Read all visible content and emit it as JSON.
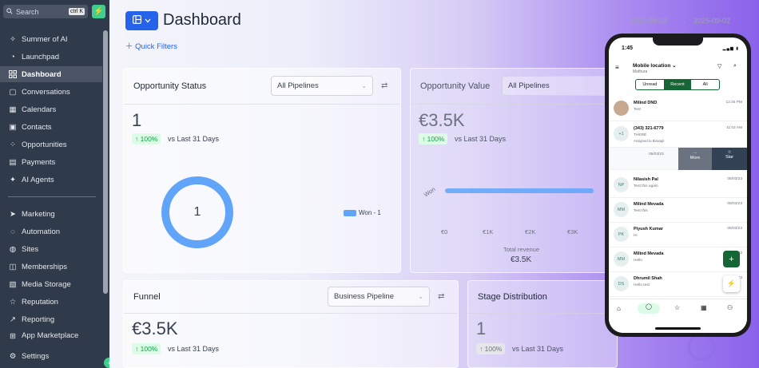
{
  "sidebar": {
    "search_placeholder": "Search",
    "search_shortcut": "ctrl K",
    "items": [
      {
        "label": "Summer of AI",
        "icon": "sparkle-icon"
      },
      {
        "label": "Launchpad",
        "icon": "rocket-icon"
      },
      {
        "label": "Dashboard",
        "icon": "grid-icon"
      },
      {
        "label": "Conversations",
        "icon": "chat-icon"
      },
      {
        "label": "Calendars",
        "icon": "calendar-icon"
      },
      {
        "label": "Contacts",
        "icon": "contacts-icon"
      },
      {
        "label": "Opportunities",
        "icon": "opportunities-icon"
      },
      {
        "label": "Payments",
        "icon": "payments-icon"
      },
      {
        "label": "AI Agents",
        "icon": "ai-agents-icon"
      },
      {
        "label": "Marketing",
        "icon": "marketing-icon"
      },
      {
        "label": "Automation",
        "icon": "automation-icon"
      },
      {
        "label": "Sites",
        "icon": "sites-icon"
      },
      {
        "label": "Memberships",
        "icon": "memberships-icon"
      },
      {
        "label": "Media Storage",
        "icon": "media-icon"
      },
      {
        "label": "Reputation",
        "icon": "star-icon"
      },
      {
        "label": "Reporting",
        "icon": "reporting-icon"
      },
      {
        "label": "App Marketplace",
        "icon": "marketplace-icon"
      }
    ],
    "settings_label": "Settings",
    "active_item": "Dashboard"
  },
  "header": {
    "title": "Dashboard",
    "quick_filters": "Quick Filters",
    "date_start": "2025-08-03",
    "date_end": "2025-09-02"
  },
  "opportunity_status": {
    "title": "Opportunity Status",
    "pipeline": "All Pipelines",
    "value": "1",
    "pct": "100%",
    "vs": "vs Last 31 Days",
    "donut_value": "1",
    "legend": "Won - 1"
  },
  "opportunity_value": {
    "title": "Opportunity Value",
    "pipeline": "All Pipelines",
    "value": "€3.5K",
    "pct": "100%",
    "vs": "vs Last 31 Days",
    "bar_label": "Won",
    "ticks": [
      "€0",
      "€1K",
      "€2K",
      "€3K"
    ],
    "total_label": "Total revenue",
    "total": "€3.5K"
  },
  "funnel": {
    "title": "Funnel",
    "pipeline": "Business Pipeline",
    "value": "€3.5K",
    "pct": "100%",
    "vs": "vs Last 31 Days"
  },
  "stage_distribution": {
    "title": "Stage Distribution",
    "value": "1",
    "pct": "100%",
    "vs": "vs Last 31 Days"
  },
  "phone": {
    "time": "1:45",
    "location": "Mobile location",
    "sublocation": "Mathura",
    "tabs": [
      "Unread",
      "Recent",
      "All"
    ],
    "active_tab": "Recent",
    "conversations": [
      {
        "initials": "",
        "name": "Milind DND",
        "msg": "Test",
        "date": "12:45 PM"
      },
      {
        "initials": "+1",
        "name": "(343) 321-6779",
        "msg": "THERE",
        "msg2": "Assigned to Biswajit",
        "date": "11:02 AM"
      },
      {
        "initials": "NP",
        "name": "Nilasish Pal",
        "msg": "Test this again",
        "date": "05/03/23"
      },
      {
        "initials": "MM",
        "name": "Milind Mevada",
        "msg": "Test this",
        "date": "05/03/23"
      },
      {
        "initials": "PK",
        "name": "Piyush Kumar",
        "msg": "Hi",
        "date": "05/03/23"
      },
      {
        "initials": "MM",
        "name": "Milind Mevada",
        "msg": "Hello",
        "date": "05/03/23"
      },
      {
        "initials": "DS",
        "name": "Dhrumil Shah",
        "msg": "Hello test",
        "date": "05/07/23"
      }
    ],
    "swipe_date": "05/03/23",
    "swipe_more": "More",
    "swipe_star": "Star"
  },
  "colors": {
    "sidebar_bg": "#2f3a4a",
    "accent": "#2563eb",
    "green": "#3ecf8e",
    "donut": "#60a5fa",
    "purple": "#8a62ea"
  }
}
